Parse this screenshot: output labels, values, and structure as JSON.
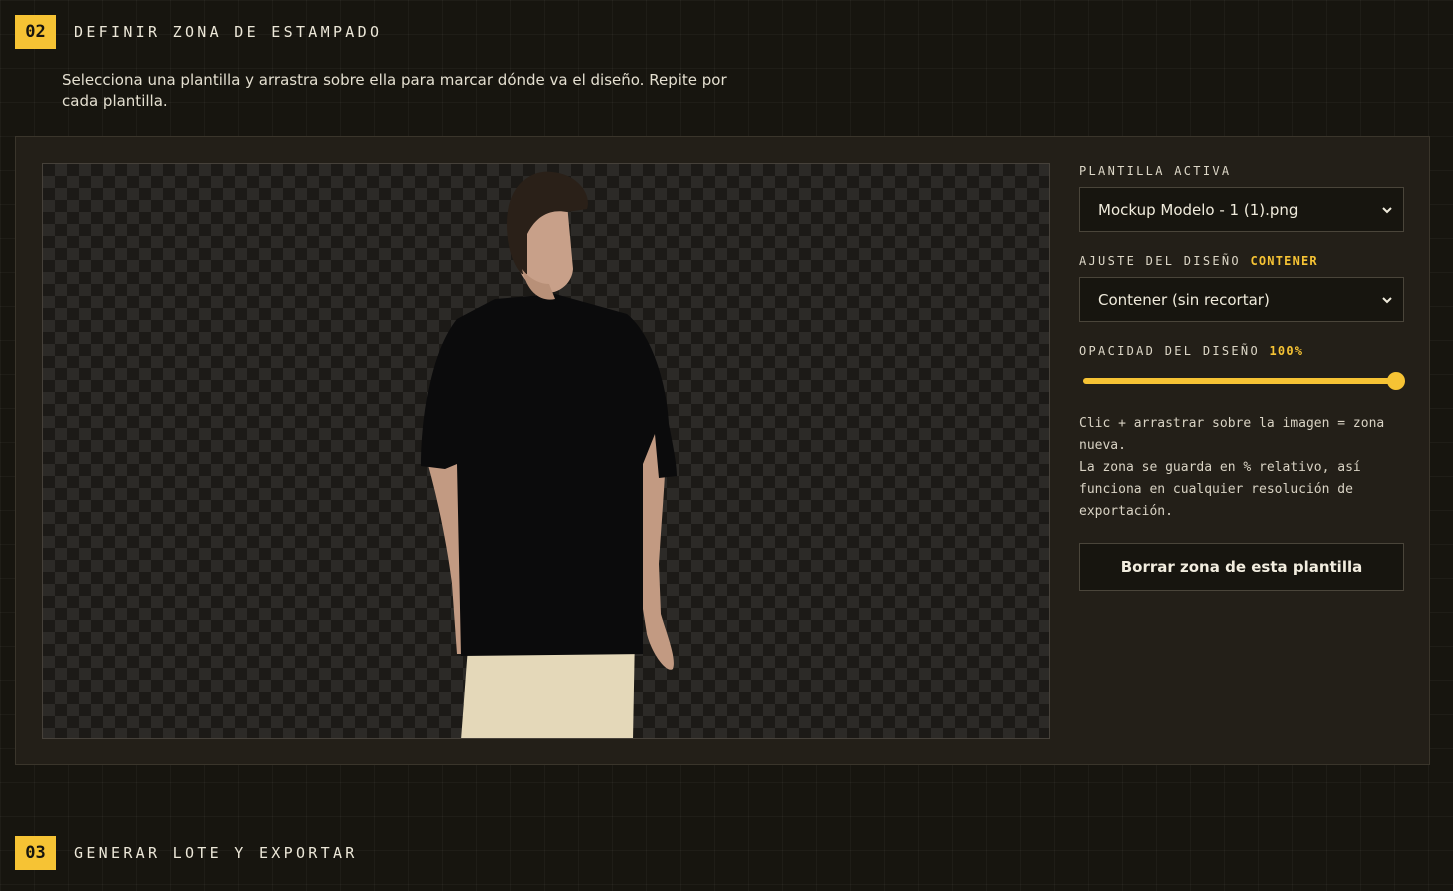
{
  "step2": {
    "number": "02",
    "title": "DEFINIR ZONA DE ESTAMPADO",
    "description": "Selecciona una plantilla y arrastra sobre ella para marcar dónde va el diseño. Repite por cada plantilla."
  },
  "sidebar": {
    "template_label": "PLANTILLA ACTIVA",
    "template_value": "Mockup Modelo - 1 (1).png",
    "fit_label": "AJUSTE DEL DISEÑO",
    "fit_badge": "CONTENER",
    "fit_value": "Contener (sin recortar)",
    "opacity_label": "OPACIDAD DEL DISEÑO",
    "opacity_value": "100%",
    "opacity_fraction": 1.0,
    "help_line1": "Clic + arrastrar sobre la imagen = zona nueva.",
    "help_line2": "La zona se guarda en % relativo, así funciona en cualquier resolución de exportación.",
    "clear_button": "Borrar zona de esta plantilla"
  },
  "step3": {
    "number": "03",
    "title": "GENERAR LOTE Y EXPORTAR"
  },
  "colors": {
    "accent": "#f6c334",
    "background": "#17150f",
    "panel": "#231f18"
  },
  "icons": {
    "select_arrow": "chevron-down-icon"
  }
}
